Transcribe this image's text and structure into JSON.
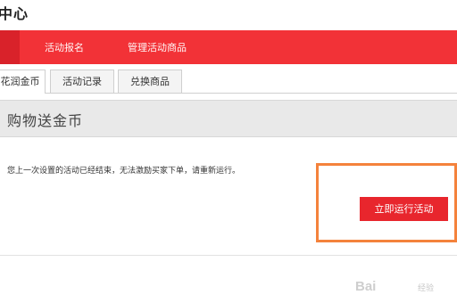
{
  "header": {
    "title": "中心"
  },
  "top_nav": {
    "items": [
      {
        "label": "活动报名"
      },
      {
        "label": "管理活动商品"
      }
    ]
  },
  "tabs": [
    {
      "label": "花润金币",
      "active": true
    },
    {
      "label": "活动记录",
      "active": false
    },
    {
      "label": "兑换商品",
      "active": false
    }
  ],
  "section": {
    "title": "购物送金币"
  },
  "notice": {
    "text": "您上一次设置的活动已经结束，无法激励买家下单，请重新运行。"
  },
  "run_button": {
    "label": "立即运行活动"
  },
  "watermark": {
    "text": "Bai",
    "sub": "经验"
  },
  "colors": {
    "accent": "#f23237",
    "button": "#e8262d",
    "highlight_border": "#f4823c"
  }
}
